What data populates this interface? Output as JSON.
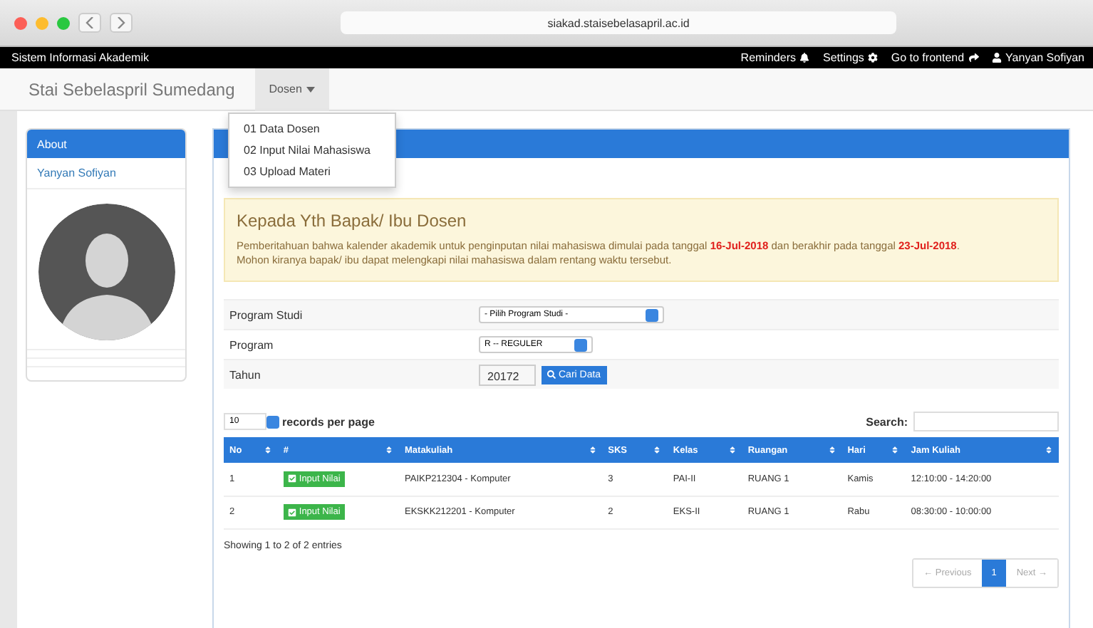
{
  "browser": {
    "url": "siakad.staisebelasapril.ac.id"
  },
  "topbar": {
    "title": "Sistem Informasi Akademik",
    "links": [
      "Reminders",
      "Settings",
      "Go to frontend",
      "Yanyan Sofiyan"
    ]
  },
  "navbar": {
    "brand": "Stai Sebelaspril Sumedang",
    "menu": {
      "label": "Dosen",
      "expanded": true,
      "items": [
        "01 Data Dosen",
        "02 Input Nilai Mahasiswa",
        "03 Upload Materi"
      ]
    }
  },
  "sidebar": {
    "heading": "About",
    "name": "Yanyan Sofiyan"
  },
  "alert": {
    "title": "Kepada Yth Bapak/ Ibu Dosen",
    "text": "Pemberitahuan bahwa kalender akademik untuk penginputan nilai mahasiswa dimulai pada tanggal **16-Jul-2018** dan berakhir pada tanggal **23-Jul-2018**.",
    "text2": "Mohon kiranya bapak/ ibu dapat melengkapi nilai mahasiswa dalam rentang waktu tersebut."
  },
  "form": [
    {
      "label": "Program Studi",
      "kind": "select",
      "value": "- Pilih Program Studi -"
    },
    {
      "label": "Program",
      "kind": "select",
      "value": "R -- REGULER"
    },
    {
      "label": "Tahun",
      "kind": "input",
      "value": "20172",
      "button": "Cari Data"
    }
  ],
  "table": {
    "page_size": "10",
    "page_size_label": "records per page",
    "search_label": "Search:",
    "columns": [
      "No",
      "#",
      "Matakuliah",
      "SKS",
      "Kelas",
      "Ruangan",
      "Hari",
      "Jam Kuliah"
    ],
    "rows": [
      {
        "no": "1",
        "action": "Input Nilai",
        "matakuliah": "PAIKP212304 - Komputer",
        "sks": "3",
        "kelas": "PAI-II",
        "ruangan": "RUANG 1",
        "hari": "Kamis",
        "jam": "12:10:00 - 14:20:00"
      },
      {
        "no": "2",
        "action": "Input Nilai",
        "matakuliah": "EKSKK212201 - Komputer",
        "sks": "2",
        "kelas": "EKS-II",
        "ruangan": "RUANG 1",
        "hari": "Rabu",
        "jam": "08:30:00 - 10:00:00"
      }
    ],
    "info": "Showing 1 to 2 of 2 entries",
    "pagination": [
      {
        "label": "← Previous",
        "selected": false
      },
      {
        "label": "1",
        "selected": true
      },
      {
        "label": "Next →",
        "selected": false
      }
    ]
  }
}
